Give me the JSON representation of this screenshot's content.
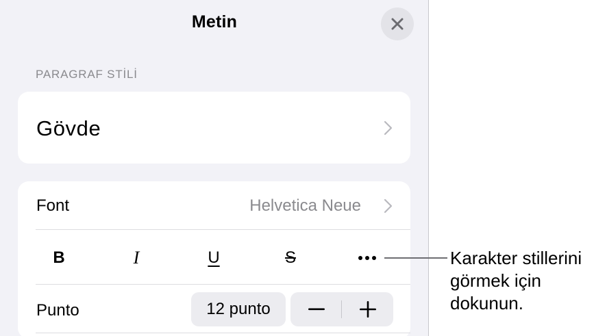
{
  "panel": {
    "title": "Metin",
    "close_icon": "close-icon"
  },
  "paragraph_style": {
    "section_label": "PARAGRAF STİLİ",
    "value": "Gövde",
    "chevron_icon": "chevron-right-icon"
  },
  "font": {
    "label": "Font",
    "value": "Helvetica Neue",
    "chevron_icon": "chevron-right-icon"
  },
  "character_styles": {
    "bold": "B",
    "italic": "I",
    "underline": "U",
    "strikethrough": "S",
    "more_icon": "ellipsis-icon"
  },
  "size": {
    "label": "Punto",
    "value": "12 punto",
    "decrease_icon": "minus-icon",
    "increase_icon": "plus-icon"
  },
  "callout": {
    "lines": [
      "Karakter stillerini",
      "görmek için",
      "dokunun."
    ]
  },
  "colors": {
    "panel_background": "#f2f2f7",
    "card_background": "#ffffff",
    "secondary_text": "#8a8a8e",
    "control_fill": "#ececf0"
  }
}
